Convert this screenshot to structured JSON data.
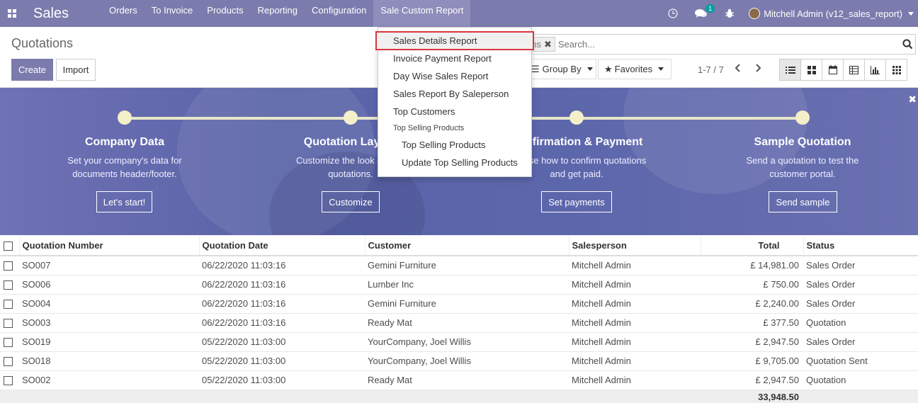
{
  "navbar": {
    "brand": "Sales",
    "menu": [
      "Orders",
      "To Invoice",
      "Products",
      "Reporting",
      "Configuration",
      "Sale Custom Report"
    ],
    "active_menu": "Sale Custom Report",
    "chat_badge": "1",
    "user": "Mitchell Admin (v12_sales_report)"
  },
  "control_panel": {
    "title": "Quotations",
    "create_label": "Create",
    "import_label": "Import",
    "facet_text": "ons",
    "search_placeholder": "Search...",
    "groupby_label": "Group By",
    "favorites_label": "Favorites",
    "pager": "1-7 / 7"
  },
  "dropdown": {
    "items": [
      "Sales Details Report",
      "Invoice Payment Report",
      "Day Wise Sales Report",
      "Sales Report By Saleperson",
      "Top Customers"
    ],
    "section_header": "Top Selling Products",
    "sub_items": [
      "Top Selling Products",
      "Update Top Selling Products"
    ]
  },
  "banner": {
    "steps": [
      {
        "title": "Company Data",
        "desc1": "Set your company's data for",
        "desc2": "documents header/footer.",
        "button": "Let's start!"
      },
      {
        "title": "Quotation Layout",
        "desc1": "Customize the look of your",
        "desc2": "quotations.",
        "button": "Customize"
      },
      {
        "title": "Confirmation & Payment",
        "desc1": "Choose how to confirm quotations",
        "desc2": "and get paid.",
        "button": "Set payments"
      },
      {
        "title": "Sample Quotation",
        "desc1": "Send a quotation to test the",
        "desc2": "customer portal.",
        "button": "Send sample"
      }
    ]
  },
  "table": {
    "headers": [
      "Quotation Number",
      "Quotation Date",
      "Customer",
      "Salesperson",
      "Total",
      "Status"
    ],
    "rows": [
      [
        "SO007",
        "06/22/2020 11:03:16",
        "Gemini Furniture",
        "Mitchell Admin",
        "£ 14,981.00",
        "Sales Order"
      ],
      [
        "SO006",
        "06/22/2020 11:03:16",
        "Lumber Inc",
        "Mitchell Admin",
        "£ 750.00",
        "Sales Order"
      ],
      [
        "SO004",
        "06/22/2020 11:03:16",
        "Gemini Furniture",
        "Mitchell Admin",
        "£ 2,240.00",
        "Sales Order"
      ],
      [
        "SO003",
        "06/22/2020 11:03:16",
        "Ready Mat",
        "Mitchell Admin",
        "£ 377.50",
        "Quotation"
      ],
      [
        "SO019",
        "05/22/2020 11:03:00",
        "YourCompany, Joel Willis",
        "Mitchell Admin",
        "£ 2,947.50",
        "Sales Order"
      ],
      [
        "SO018",
        "05/22/2020 11:03:00",
        "YourCompany, Joel Willis",
        "Mitchell Admin",
        "£ 9,705.00",
        "Quotation Sent"
      ],
      [
        "SO002",
        "05/22/2020 11:03:00",
        "Ready Mat",
        "Mitchell Admin",
        "£ 2,947.50",
        "Quotation"
      ]
    ],
    "total": "33,948.50"
  },
  "colors": {
    "brand": "#7c7bad",
    "highlight_border": "#d9363e"
  }
}
